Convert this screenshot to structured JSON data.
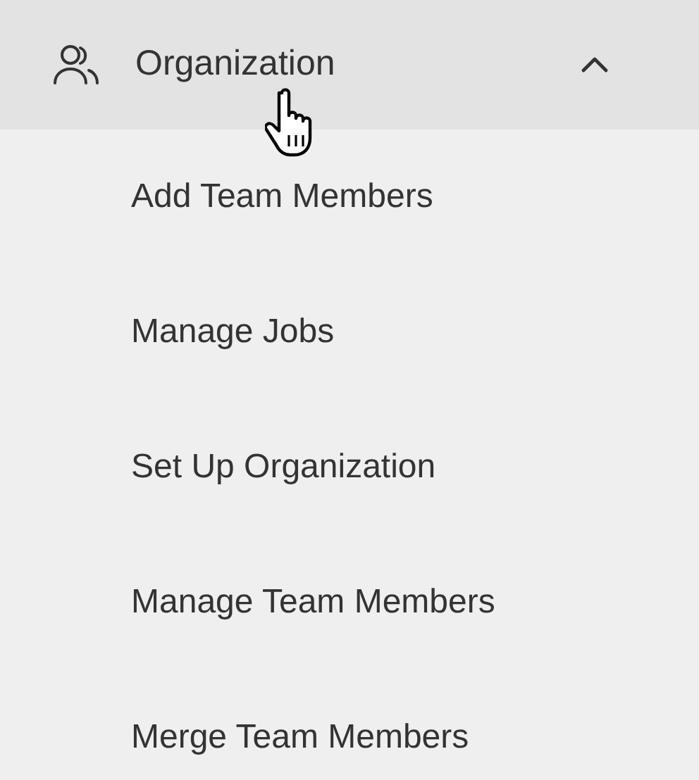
{
  "menu": {
    "label": "Organization",
    "expanded": true,
    "hovered": true,
    "items": [
      {
        "label": "Add Team Members"
      },
      {
        "label": "Manage Jobs"
      },
      {
        "label": "Set Up Organization"
      },
      {
        "label": "Manage Team Members"
      },
      {
        "label": "Merge Team Members"
      }
    ]
  }
}
